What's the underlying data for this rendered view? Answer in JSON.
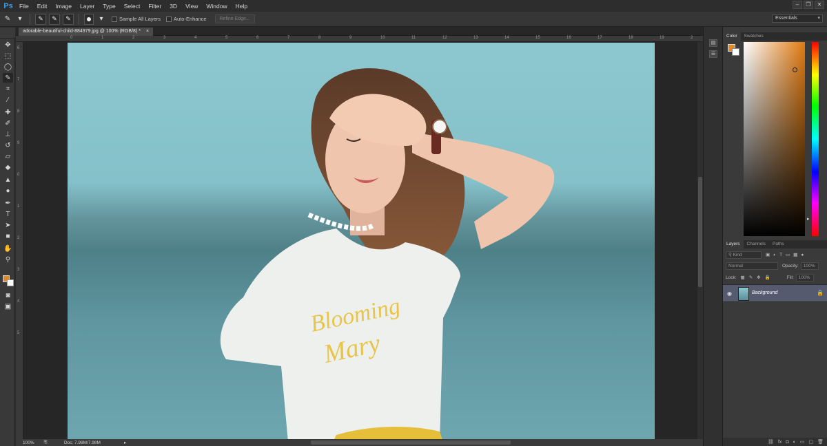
{
  "app": {
    "logo": "Ps"
  },
  "menu": [
    "File",
    "Edit",
    "Image",
    "Layer",
    "Type",
    "Select",
    "Filter",
    "3D",
    "View",
    "Window",
    "Help"
  ],
  "options_bar": {
    "sample_all_layers": "Sample All Layers",
    "auto_enhance": "Auto-Enhance",
    "refine_edge": "Refine Edge...",
    "workspace": "Essentials"
  },
  "document": {
    "tab_title": "adorable-beautiful-child-884979.jpg @ 100% (RGB/8) *",
    "close": "×",
    "shirt_text_1": "Blooming",
    "shirt_text_2": "Mary"
  },
  "ruler_top": [
    "0",
    "1",
    "2",
    "3",
    "4",
    "5",
    "6",
    "7",
    "8",
    "9",
    "10",
    "11",
    "12",
    "13",
    "14",
    "15",
    "16",
    "17",
    "18",
    "19",
    "2"
  ],
  "ruler_left": [
    "6",
    "7",
    "8",
    "9",
    "0",
    "1",
    "2",
    "3",
    "4",
    "5"
  ],
  "status": {
    "zoom": "100%",
    "doc": "Doc: 7.98M/7.98M"
  },
  "color_panel": {
    "tabs": [
      "Color",
      "Swatches"
    ],
    "foreground": "#e08a25",
    "background": "#ffffff"
  },
  "layers_panel": {
    "tabs": [
      "Layers",
      "Channels",
      "Paths"
    ],
    "filter": "Kind",
    "blend_mode": "Normal",
    "opacity_label": "Opacity:",
    "opacity_value": "100%",
    "lock_label": "Lock:",
    "fill_label": "Fill:",
    "fill_value": "100%",
    "layer_name": "Background"
  }
}
